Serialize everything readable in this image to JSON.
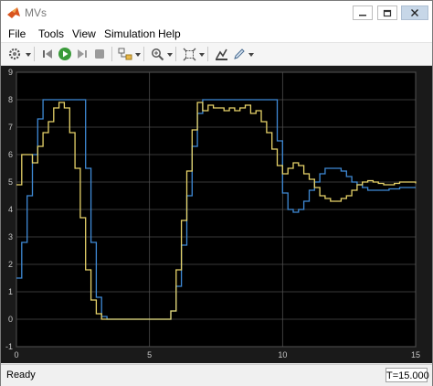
{
  "window": {
    "title": "MVs"
  },
  "menu": [
    "File",
    "Tools",
    "View",
    "Simulation",
    "Help"
  ],
  "toolbar": {
    "icons": [
      "gear-icon",
      "step-back-icon",
      "run-icon",
      "step-forward-icon",
      "stop-icon",
      "highlight-block-icon",
      "zoom-icon",
      "fit-to-view-icon",
      "style-icon",
      "edit-icon"
    ]
  },
  "status": {
    "text": "Ready",
    "time": "T=15.000"
  },
  "colors": {
    "background": "#000000",
    "axes": "#1a1a1a",
    "grid": "#4d4d4d",
    "series1": "#3f8ad6",
    "series2": "#e8d46a"
  },
  "chart_data": {
    "type": "line",
    "xlim": [
      0,
      15
    ],
    "ylim": [
      -1,
      9
    ],
    "xticks": [
      "0",
      "5",
      "10",
      "15"
    ],
    "yticks": [
      "-1",
      "0",
      "1",
      "2",
      "3",
      "4",
      "5",
      "6",
      "7",
      "8",
      "9"
    ],
    "grid": true,
    "series": [
      {
        "color": "#3f8ad6",
        "x": [
          0,
          0.2,
          0.4,
          0.6,
          0.8,
          1.0,
          1.2,
          1.4,
          1.6,
          1.8,
          2.0,
          2.2,
          2.4,
          2.6,
          2.8,
          3.0,
          3.2,
          3.4,
          3.6,
          3.8,
          4.0,
          4.2,
          4.4,
          4.6,
          4.8,
          5.0,
          5.2,
          5.4,
          5.6,
          5.8,
          6.0,
          6.2,
          6.4,
          6.6,
          6.8,
          7.0,
          7.2,
          7.4,
          7.6,
          7.8,
          8.0,
          8.2,
          8.4,
          8.6,
          8.8,
          9.0,
          9.2,
          9.4,
          9.6,
          9.8,
          10.0,
          10.2,
          10.4,
          10.6,
          10.8,
          11.0,
          11.2,
          11.4,
          11.6,
          11.8,
          12.0,
          12.2,
          12.4,
          12.6,
          12.8,
          13.0,
          13.2,
          13.4,
          13.6,
          13.8,
          14.0,
          14.2,
          14.4,
          14.6,
          14.8,
          15.0
        ],
        "y": [
          1.5,
          2.8,
          4.5,
          6.0,
          7.3,
          8.0,
          8.0,
          8.0,
          8.0,
          8.0,
          8.0,
          8.0,
          8.0,
          5.5,
          2.8,
          0.8,
          0.1,
          0.0,
          0.0,
          0.0,
          0.0,
          0.0,
          0.0,
          0.0,
          0.0,
          0.0,
          0.0,
          0.0,
          0.0,
          0.3,
          1.2,
          2.7,
          4.5,
          6.3,
          7.5,
          8.0,
          8.0,
          8.0,
          8.0,
          8.0,
          8.0,
          8.0,
          8.0,
          8.0,
          8.0,
          8.0,
          8.0,
          8.0,
          8.0,
          6.5,
          4.6,
          4.0,
          3.9,
          4.0,
          4.3,
          4.7,
          5.0,
          5.3,
          5.5,
          5.5,
          5.5,
          5.4,
          5.2,
          5.0,
          4.9,
          4.8,
          4.7,
          4.7,
          4.7,
          4.7,
          4.75,
          4.75,
          4.8,
          4.8,
          4.8,
          4.8
        ]
      },
      {
        "color": "#e8d46a",
        "x": [
          0,
          0.2,
          0.4,
          0.6,
          0.8,
          1.0,
          1.2,
          1.4,
          1.6,
          1.8,
          2.0,
          2.2,
          2.4,
          2.6,
          2.8,
          3.0,
          3.2,
          3.4,
          3.6,
          3.8,
          4.0,
          4.2,
          4.4,
          4.6,
          4.8,
          5.0,
          5.2,
          5.4,
          5.6,
          5.8,
          6.0,
          6.2,
          6.4,
          6.6,
          6.8,
          7.0,
          7.2,
          7.4,
          7.6,
          7.8,
          8.0,
          8.2,
          8.4,
          8.6,
          8.8,
          9.0,
          9.2,
          9.4,
          9.6,
          9.8,
          10.0,
          10.2,
          10.4,
          10.6,
          10.8,
          11.0,
          11.2,
          11.4,
          11.6,
          11.8,
          12.0,
          12.2,
          12.4,
          12.6,
          12.8,
          13.0,
          13.2,
          13.4,
          13.6,
          13.8,
          14.0,
          14.2,
          14.4,
          14.6,
          14.8,
          15.0
        ],
        "y": [
          4.9,
          6.0,
          6.0,
          5.7,
          6.3,
          6.8,
          7.2,
          7.7,
          7.9,
          7.7,
          6.8,
          5.5,
          3.7,
          1.8,
          0.7,
          0.2,
          0.0,
          0.0,
          0.0,
          0.0,
          0.0,
          0.0,
          0.0,
          0.0,
          0.0,
          0.0,
          0.0,
          0.0,
          0.0,
          0.3,
          1.8,
          3.6,
          5.4,
          6.9,
          7.9,
          7.6,
          7.8,
          7.7,
          7.7,
          7.6,
          7.7,
          7.6,
          7.7,
          7.8,
          7.5,
          7.6,
          7.2,
          6.8,
          6.2,
          5.6,
          5.3,
          5.5,
          5.7,
          5.6,
          5.3,
          5.1,
          4.8,
          4.5,
          4.4,
          4.3,
          4.3,
          4.4,
          4.5,
          4.7,
          4.9,
          5.0,
          5.05,
          5.0,
          4.95,
          4.9,
          4.9,
          4.95,
          5.0,
          5.0,
          5.0,
          4.95
        ]
      }
    ]
  }
}
